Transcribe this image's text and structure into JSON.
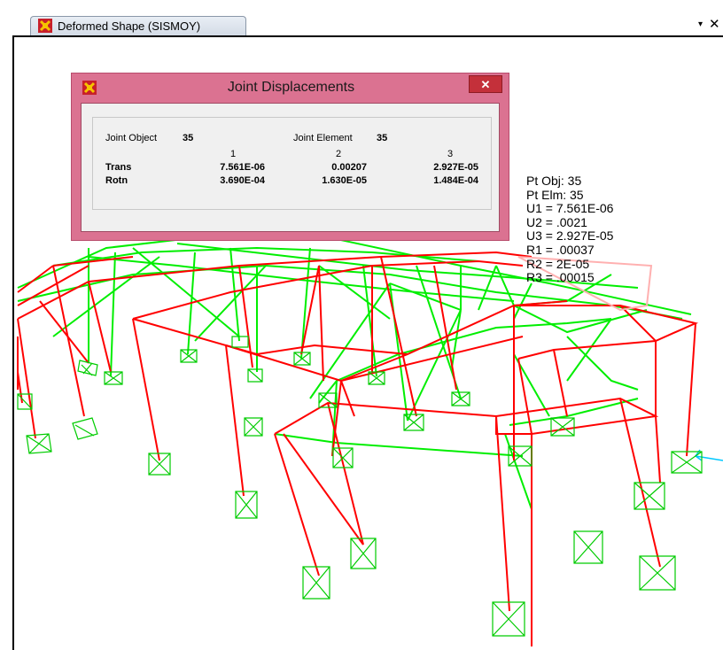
{
  "tab": {
    "title": "Deformed Shape (SISMOY)",
    "menu_glyph": "▾",
    "close_glyph": "✕"
  },
  "dialog": {
    "title": "Joint Displacements",
    "close_glyph": "✕",
    "joint_object_label": "Joint  Object",
    "joint_object_value": "35",
    "joint_element_label": "Joint Element",
    "joint_element_value": "35",
    "columns": [
      "1",
      "2",
      "3"
    ],
    "rows": [
      {
        "label": "Trans",
        "values": [
          "7.561E-06",
          "0.00207",
          "2.927E-05"
        ]
      },
      {
        "label": "Rotn",
        "values": [
          "3.690E-04",
          "1.630E-05",
          "1.484E-04"
        ]
      }
    ]
  },
  "readout": [
    "Pt Obj: 35",
    "Pt Elm: 35",
    "U1 =  7.561E-06",
    "U2 =  .0021",
    "U3 =  2.927E-05",
    "R1 =  .00037",
    "R2 =  2E-05",
    "R3 =  .00015"
  ],
  "colors": {
    "frame": "#ff0000",
    "deformed": "#00ee00",
    "support": "#00cc00",
    "selection": "#00c8ff",
    "dialog_title_bar": "#db7291"
  },
  "icons": [
    "app-logo-icon",
    "dropdown-arrow-icon",
    "close-icon",
    "support-restraint-icon"
  ]
}
